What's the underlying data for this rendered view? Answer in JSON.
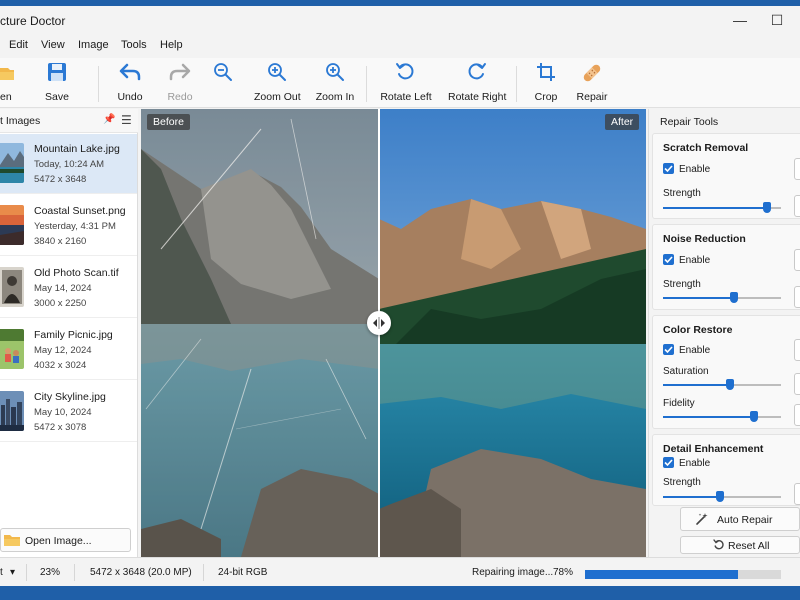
{
  "window": {
    "title": "cture Doctor"
  },
  "menu": [
    "Edit",
    "View",
    "Image",
    "Tools",
    "Help"
  ],
  "toolbar": {
    "open": "en",
    "save": "Save",
    "undo": "Undo",
    "redo": "Redo",
    "zoom_out": "Zoom Out",
    "zoom_in": "Zoom In",
    "rotate_left": "Rotate Left",
    "rotate_right": "Rotate Right",
    "crop": "Crop",
    "repair": "Repair"
  },
  "left_panel": {
    "title": "t Images",
    "items": [
      {
        "name": "Mountain Lake.jpg",
        "date": "Today, 10:24 AM",
        "dims": "5472 x 3648",
        "selected": true
      },
      {
        "name": "Coastal Sunset.png",
        "date": "Yesterday, 4:31 PM",
        "dims": "3840 x 2160",
        "selected": false
      },
      {
        "name": "Old Photo Scan.tif",
        "date": "May 14, 2024",
        "dims": "3000 x 2250",
        "selected": false
      },
      {
        "name": "Family Picnic.jpg",
        "date": "May 12, 2024",
        "dims": "4032 x 3024",
        "selected": false
      },
      {
        "name": "City Skyline.jpg",
        "date": "May 10, 2024",
        "dims": "5472 x 3078",
        "selected": false
      }
    ],
    "open_button": "Open Image..."
  },
  "canvas": {
    "before_label": "Before",
    "after_label": "After",
    "split_fraction": 0.47
  },
  "repair_tools": {
    "title": "Repair Tools",
    "sections": [
      {
        "title": "Scratch Removal",
        "enable": "Enable",
        "sliders": [
          {
            "label": "Strength",
            "value": 0.88
          }
        ]
      },
      {
        "title": "Noise Reduction",
        "enable": "Enable",
        "sliders": [
          {
            "label": "Strength",
            "value": 0.6
          }
        ]
      },
      {
        "title": "Color Restore",
        "enable": "Enable",
        "sliders": [
          {
            "label": "Saturation",
            "value": 0.57
          },
          {
            "label": "Fidelity",
            "value": 0.77
          }
        ]
      },
      {
        "title": "Detail Enhancement",
        "enable": "Enable",
        "sliders": [
          {
            "label": "Strength",
            "value": 0.48
          }
        ]
      }
    ],
    "auto_repair": "Auto Repair",
    "reset_all": "Reset All"
  },
  "status": {
    "mode": "t",
    "zoom": "23%",
    "size": "5472 x 3648 (20.0 MP)",
    "depth": "24-bit RGB",
    "progress_text": "Repairing image...",
    "progress_percent": "78%",
    "progress_value": 0.78
  },
  "colors": {
    "accent": "#1f6fcf",
    "desktop": "#1f5fa8"
  }
}
